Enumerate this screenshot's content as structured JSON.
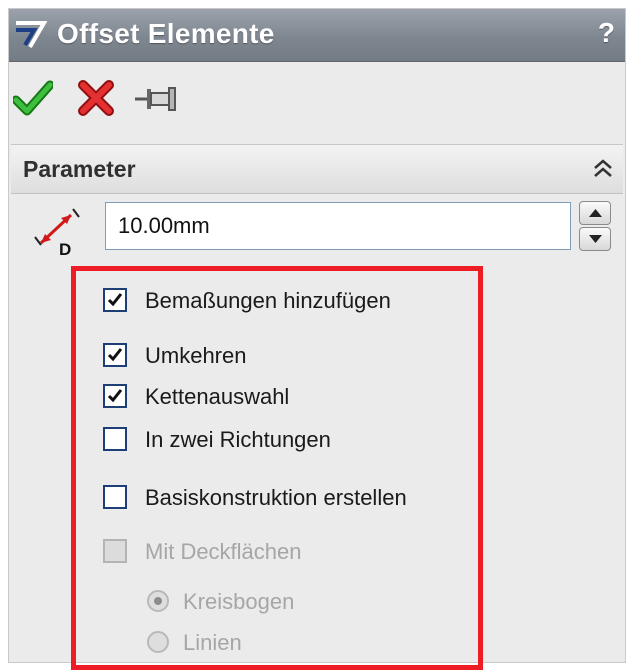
{
  "dialog": {
    "title": "Offset Elemente",
    "help_glyph": "?",
    "icons": {
      "logo": "solidworks-ds-logo-icon",
      "ok": "green-checkmark-icon",
      "cancel": "red-x-icon",
      "pin": "push-pin-icon",
      "help": "question-mark-icon",
      "collapse": "double-chevron-up-icon",
      "distance": "offset-distance-icon",
      "spin_up": "spin-up-arrow-icon",
      "spin_down": "spin-down-arrow-icon"
    },
    "colors": {
      "title_bar": "#7e8690",
      "highlight_frame": "#ee1c24",
      "ok_green": "#2fa22f",
      "cancel_red": "#d42020"
    }
  },
  "parameter_group": {
    "title": "Parameter",
    "distance_icon_letter": "D",
    "distance_value": "10.00mm",
    "options": {
      "dimensions": {
        "label": "Bemaßungen hinzufügen",
        "checked": true,
        "enabled": true
      },
      "reverse": {
        "label": "Umkehren",
        "checked": true,
        "enabled": true
      },
      "chain": {
        "label": "Kettenauswahl",
        "checked": true,
        "enabled": true
      },
      "bidirectional": {
        "label": "In zwei Richtungen",
        "checked": false,
        "enabled": true
      },
      "construction": {
        "label": "Basiskonstruktion erstellen",
        "checked": false,
        "enabled": true
      },
      "caps": {
        "label": "Mit Deckflächen",
        "checked": false,
        "enabled": false
      }
    },
    "cap_type": {
      "arc": {
        "label": "Kreisbogen",
        "selected": true,
        "enabled": false
      },
      "lines": {
        "label": "Linien",
        "selected": false,
        "enabled": false
      }
    }
  }
}
